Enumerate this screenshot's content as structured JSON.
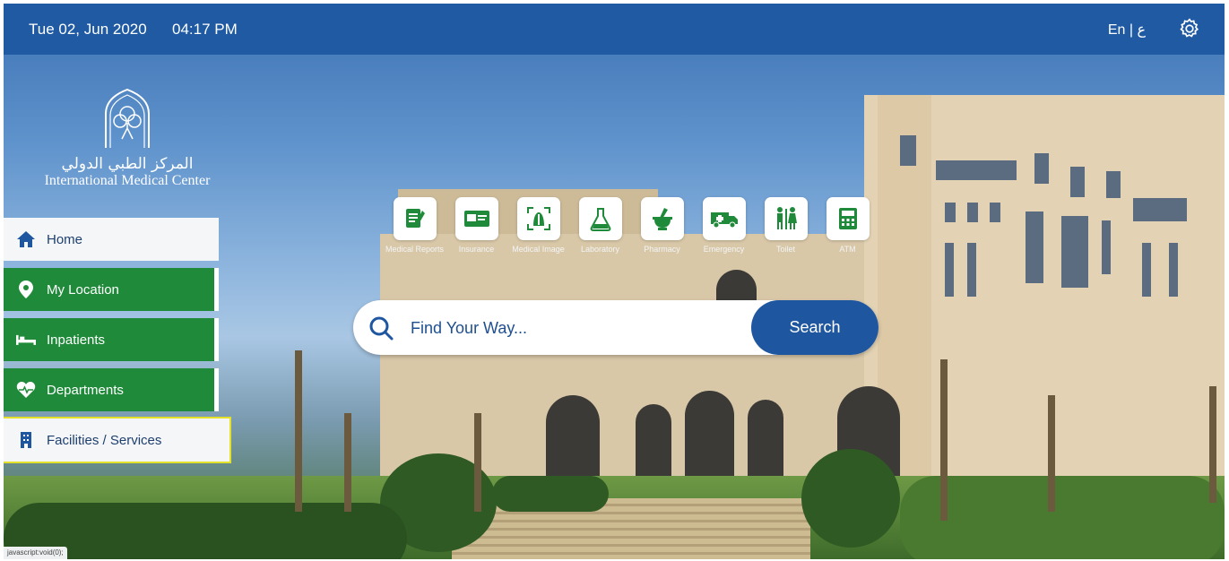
{
  "header": {
    "date": "Tue 02, Jun 2020",
    "time": "04:17 PM",
    "language_toggle": "En | ع",
    "settings_icon": "gear-icon"
  },
  "logo": {
    "arabic_name": "المركز الطبي الدولي",
    "english_name": "International Medical Center"
  },
  "sidebar": {
    "items": [
      {
        "label": "Home",
        "icon": "home-icon",
        "state": "white"
      },
      {
        "label": "My Location",
        "icon": "location-pin-icon",
        "state": "green"
      },
      {
        "label": "Inpatients",
        "icon": "bed-icon",
        "state": "green"
      },
      {
        "label": "Departments",
        "icon": "heart-pulse-icon",
        "state": "green"
      },
      {
        "label": "Facilities / Services",
        "icon": "building-icon",
        "state": "selected"
      }
    ]
  },
  "services": [
    {
      "label": "Medical Reports",
      "icon": "report-icon"
    },
    {
      "label": "Insurance",
      "icon": "insurance-card-icon"
    },
    {
      "label": "Medical Image",
      "icon": "xray-icon"
    },
    {
      "label": "Laboratory",
      "icon": "flask-icon"
    },
    {
      "label": "Pharmacy",
      "icon": "mortar-pestle-icon"
    },
    {
      "label": "Emergency",
      "icon": "ambulance-icon"
    },
    {
      "label": "Toilet",
      "icon": "restroom-icon"
    },
    {
      "label": "ATM",
      "icon": "atm-icon"
    }
  ],
  "search": {
    "placeholder": "Find Your Way...",
    "button_label": "Search"
  },
  "status": {
    "text": "javascript:void(0);"
  },
  "colors": {
    "topbar": "#1f5aa3",
    "nav_green": "#1f8b3a",
    "search_button": "#1f56a0",
    "selection_outline": "#e5e02a"
  }
}
